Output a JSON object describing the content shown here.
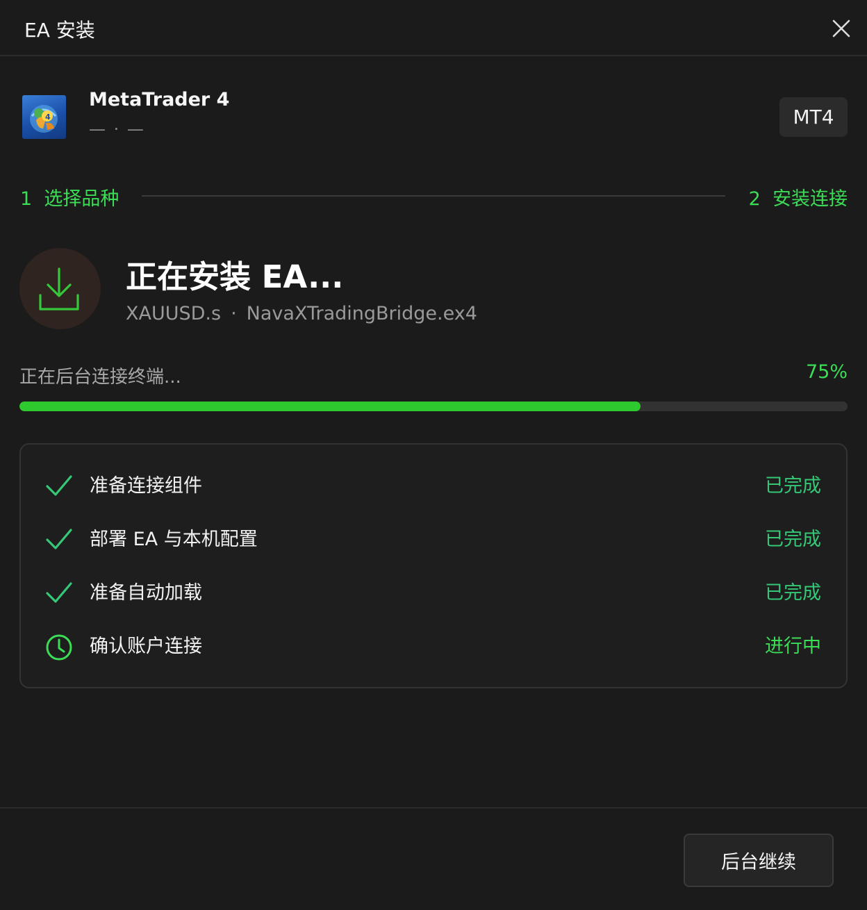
{
  "window": {
    "title": "EA 安装"
  },
  "app": {
    "name": "MetaTrader 4",
    "subtitle": "— · —",
    "badge": "MT4"
  },
  "steps": [
    {
      "number": "1",
      "label": "选择品种"
    },
    {
      "number": "2",
      "label": "安装连接"
    }
  ],
  "install": {
    "title": "正在安装 EA...",
    "symbol": "XAUUSD.s",
    "separator": "·",
    "file": "NavaXTradingBridge.ex4"
  },
  "progress": {
    "status": "正在后台连接终端...",
    "percent_label": "75%",
    "value": 0.75
  },
  "tasks": [
    {
      "label": "准备连接组件",
      "status": "已完成",
      "state": "done"
    },
    {
      "label": "部署 EA 与本机配置",
      "status": "已完成",
      "state": "done"
    },
    {
      "label": "准备自动加载",
      "status": "已完成",
      "state": "done"
    },
    {
      "label": "确认账户连接",
      "status": "进行中",
      "state": "progress"
    }
  ],
  "footer": {
    "continue_label": "后台继续"
  },
  "colors": {
    "background": "#1b1b1b",
    "accent_green": "#3ddc57",
    "progress_green": "#2ec92e",
    "done_green": "#35c877"
  }
}
